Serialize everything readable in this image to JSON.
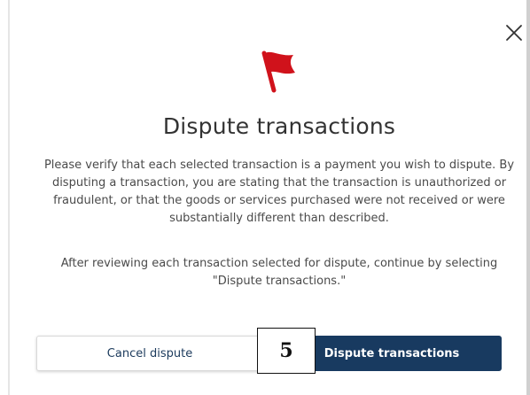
{
  "dialog": {
    "title": "Dispute transactions",
    "body_paragraph_1": "Please verify that each selected transaction is a payment you wish to dispute. By disputing a transaction, you are stating that the transaction is unauthorized or fraudulent, or that the goods or services purchased were not received or were substantially different than described.",
    "body_paragraph_2": "After reviewing each transaction selected for dispute, continue by selecting \"Dispute transactions.\"",
    "cancel_label": "Cancel dispute",
    "confirm_label": "Dispute transactions",
    "close_icon": "close-icon",
    "flag_icon": "flag-icon"
  },
  "step_marker": {
    "label": "5"
  },
  "colors": {
    "flag": "#d0121b",
    "primary_button": "#183a60",
    "cancel_text": "#1b3a5c",
    "title_text": "#333333",
    "body_text": "#4a4a4a"
  }
}
